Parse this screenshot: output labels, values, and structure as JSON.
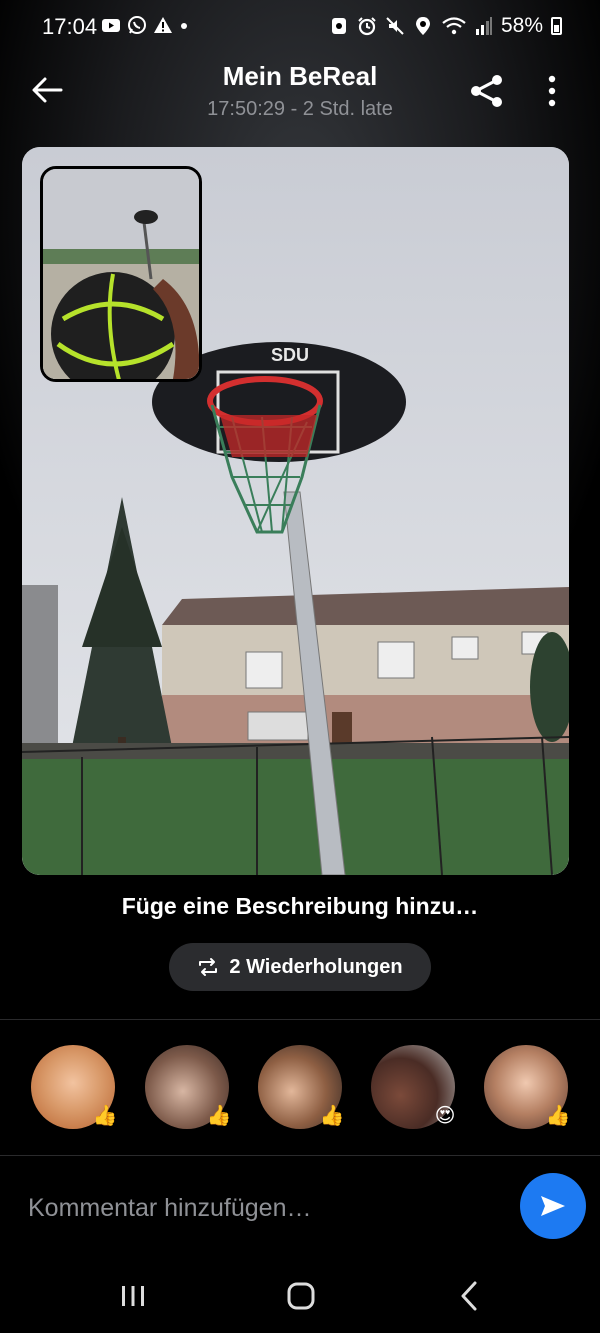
{
  "status_bar": {
    "time": "17:04",
    "battery": "58%",
    "icons": [
      "youtube-icon",
      "whatsapp-icon",
      "warning-icon",
      "dot-icon",
      "screenshot-icon",
      "alarm-icon",
      "mute-icon",
      "location-icon",
      "wifi-icon",
      "signal-icon",
      "battery-icon"
    ]
  },
  "header": {
    "title": "Mein BeReal",
    "subtitle": "17:50:29 - 2 Std. late"
  },
  "photo": {
    "backboard_text": "SDU"
  },
  "caption": "Füge eine Beschreibung hinzu…",
  "repeats": {
    "label": "2 Wiederholungen",
    "icon": "repeat-icon"
  },
  "reactions": [
    {
      "emoji": "👍"
    },
    {
      "emoji": "👍"
    },
    {
      "emoji": "👍"
    },
    {
      "emoji": "😍"
    },
    {
      "emoji": "👍"
    }
  ],
  "comment": {
    "placeholder": "Kommentar hinzufügen…"
  },
  "colors": {
    "accent": "#1d7af2",
    "subtitle": "#8f9196",
    "pill": "#2b2c2f"
  }
}
